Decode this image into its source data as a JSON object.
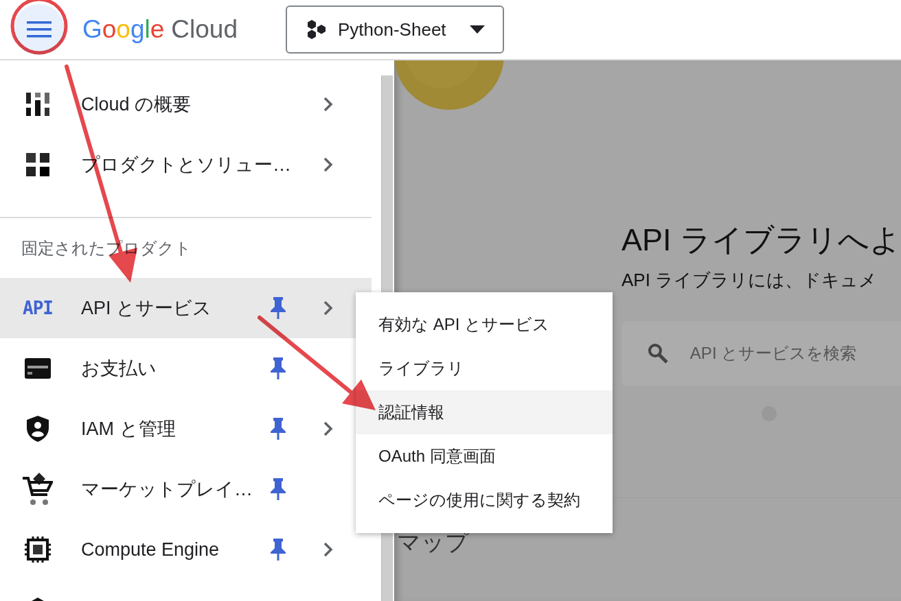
{
  "header": {
    "menu_button": {
      "highlighted": true
    },
    "logo": {
      "brand": "Google",
      "product": "Cloud"
    },
    "project_picker": {
      "label": "Python-Sheet"
    }
  },
  "sidebar": {
    "items": [
      {
        "label": "Cloud の概要",
        "has_submenu": true
      },
      {
        "label": "プロダクトとソリュー…",
        "has_submenu": true
      }
    ],
    "pinned_heading": "固定されたプロダクト",
    "pinned_items": [
      {
        "label": "API とサービス",
        "badge": "API",
        "pinned": true,
        "has_submenu": true,
        "selected": true
      },
      {
        "label": "お支払い",
        "pinned": true,
        "has_submenu": false,
        "selected": false
      },
      {
        "label": "IAM と管理",
        "pinned": true,
        "has_submenu": true,
        "selected": false
      },
      {
        "label": "マーケットプレイ…",
        "pinned": true,
        "has_submenu": false,
        "selected": false
      },
      {
        "label": "Compute Engine",
        "pinned": true,
        "has_submenu": true,
        "selected": false
      }
    ]
  },
  "submenu": {
    "items": [
      {
        "label": "有効な API とサービス",
        "selected": false
      },
      {
        "label": "ライブラリ",
        "selected": false
      },
      {
        "label": "認証情報",
        "selected": true
      },
      {
        "label": "OAuth 同意画面",
        "selected": false
      },
      {
        "label": "ページの使用に関する契約",
        "selected": false
      }
    ]
  },
  "main": {
    "heading": "API ライブラリへよ",
    "subtitle": "API ライブラリには、ドキュメ",
    "search": {
      "placeholder": "API とサービスを検索"
    },
    "section_title": "マップ"
  }
}
